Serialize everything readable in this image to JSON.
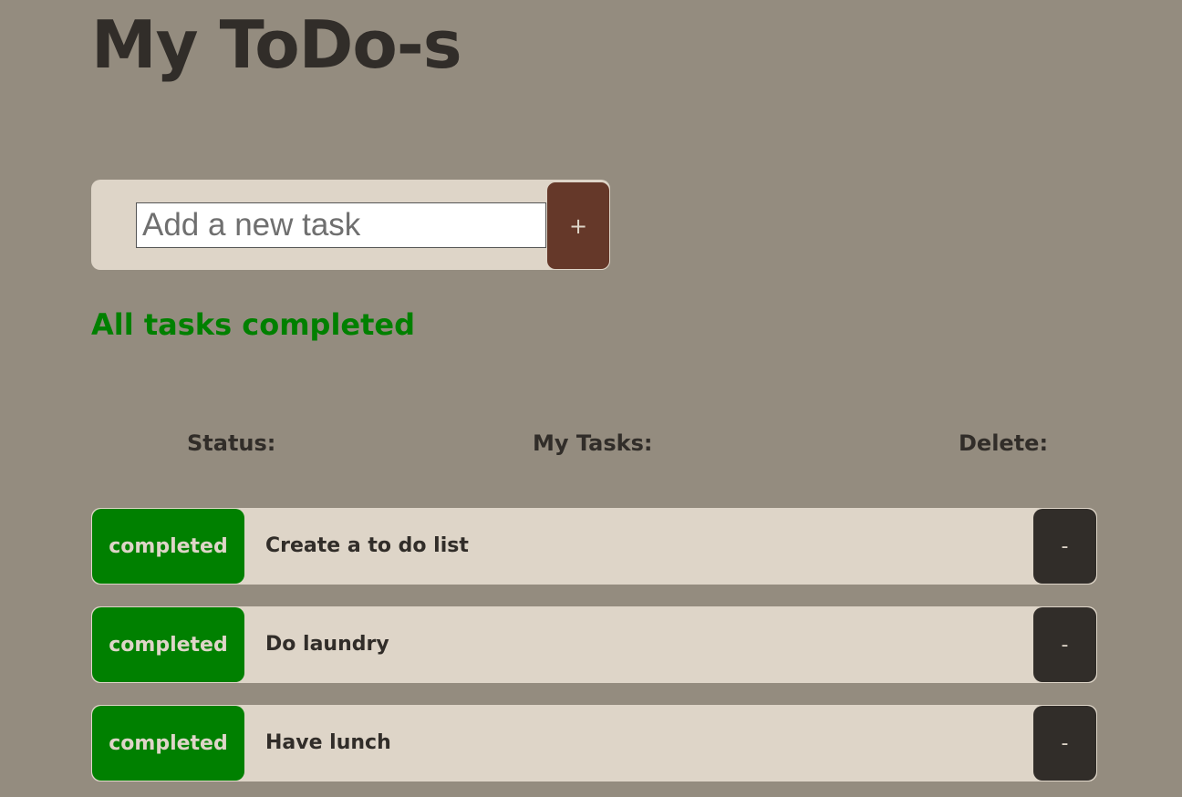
{
  "header": {
    "title": "My ToDo-s"
  },
  "add_form": {
    "input_placeholder": "Add a new task",
    "input_value": "",
    "add_label": "+"
  },
  "summary": {
    "text": "All tasks completed",
    "color": "#008000"
  },
  "columns": {
    "status": "Status:",
    "tasks": "My Tasks:",
    "delete": "Delete:"
  },
  "tasks": [
    {
      "status": "completed",
      "text": "Create a to do list",
      "delete_label": "-"
    },
    {
      "status": "completed",
      "text": "Do laundry",
      "delete_label": "-"
    },
    {
      "status": "completed",
      "text": "Have lunch",
      "delete_label": "-"
    }
  ],
  "colors": {
    "background": "#948c7f",
    "panel": "#ded5c8",
    "text": "#312d29",
    "add_button": "#653829",
    "completed": "#008000",
    "delete_button": "#312d29"
  }
}
